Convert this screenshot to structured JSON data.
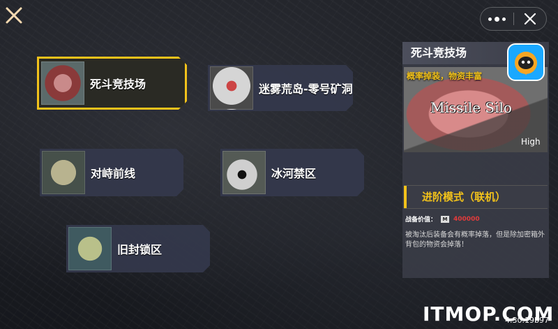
{
  "app": {
    "maps": [
      {
        "name": "死斗竞技场",
        "selected": true
      },
      {
        "name": "迷雾荒岛-零号矿洞",
        "selected": false
      },
      {
        "name": "对峙前线",
        "selected": false
      },
      {
        "name": "冰河禁区",
        "selected": false
      },
      {
        "name": "旧封锁区",
        "selected": false
      }
    ]
  },
  "detail": {
    "title": "死斗竞技场",
    "subtitle": "概率掉装，物资丰富",
    "image_text": "Missile Silo",
    "image_text2": "High",
    "mode": "进阶模式（联机）",
    "value_label": "战备价值：",
    "value_icon": "M",
    "value": "400000",
    "description": "被淘汰后装备会有概率掉落，但是除加密箱外背包的物资会掉落！"
  },
  "watermark": "ITMOP.COM",
  "version": "4.30.19b97",
  "colors": {
    "accent": "#f2c21b",
    "value": "#e23b3b"
  }
}
